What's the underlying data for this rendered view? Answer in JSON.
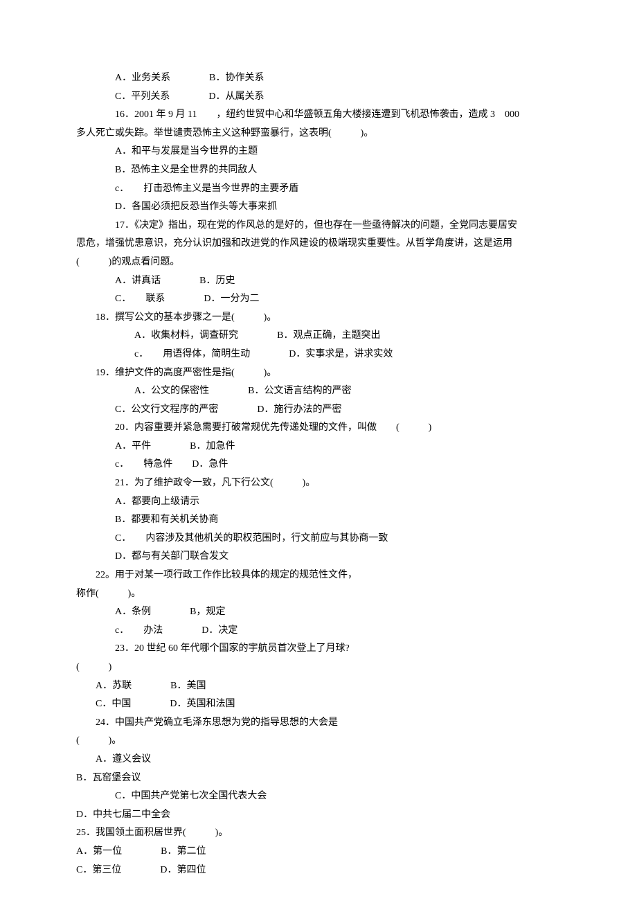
{
  "lines": [
    {
      "cls": "indent1",
      "text": "A．业务关系　　　　B．协作关系"
    },
    {
      "cls": "indent1",
      "text": "C．平列关系　　　　D．从属关系"
    },
    {
      "cls": "indent1",
      "text": "16．2001 年 9 月 11　　，纽约世贸中心和华盛顿五角大楼接连遭到飞机恐怖袭击，造成 3　000"
    },
    {
      "cls": "indent0",
      "text": "多人死亡或失踪。举世谴责恐怖主义这种野蛮暴行，这表明(　　　)。"
    },
    {
      "cls": "indent1",
      "text": "A．和平与发展是当今世界的主题"
    },
    {
      "cls": "indent1",
      "text": "B．恐怖主义是全世界的共同敌人"
    },
    {
      "cls": "indent1",
      "text": "c．　　打击恐怖主义是当今世界的主要矛盾"
    },
    {
      "cls": "indent1",
      "text": "D．各国必须把反恐当作头等大事来抓"
    },
    {
      "cls": "indent1",
      "text": "17．《决定》指出，现在党的作风总的是好的，但也存在一些亟待解决的问题，全党同志要居安"
    },
    {
      "cls": "indent0",
      "text": "思危，增强忧患意识，充分认识加强和改进党的作风建设的极端现实重要性。从哲学角度讲，这是运用"
    },
    {
      "cls": "indent0",
      "text": "(　　　)的观点看问题。"
    },
    {
      "cls": "indent1",
      "text": "A．讲真话　　　　B．历史"
    },
    {
      "cls": "indent1",
      "text": "C．　　联系　　　　D．一分为二"
    },
    {
      "cls": "indent-small",
      "text": "18．撰写公文的基本步骤之一是(　　　)。"
    },
    {
      "cls": "indent2",
      "text": "A．收集材料，调查研究　　　　B．观点正确，主题突出"
    },
    {
      "cls": "indent2",
      "text": "c．　　用语得体，简明生动　　　　D．实事求是，讲求实效"
    },
    {
      "cls": "indent-small",
      "text": "19．维护文件的高度严密性是指(　　　)。"
    },
    {
      "cls": "indent2",
      "text": "A．公文的保密性　　　　B．公文语言结构的严密"
    },
    {
      "cls": "indent1",
      "text": "C．公文行文程序的严密　　　　D．施行办法的严密"
    },
    {
      "cls": "indent1",
      "text": "20．内容重要并紧急需要打破常规优先传递处理的文件，叫做　　(　　　)"
    },
    {
      "cls": "indent1",
      "text": "A．平件　　　　B．加急件"
    },
    {
      "cls": "indent1",
      "text": "c．　　特急件　　D．急件"
    },
    {
      "cls": "indent1",
      "text": "21．为了维护政令一致，凡下行公文(　　　)。"
    },
    {
      "cls": "indent1",
      "text": "A．都要向上级请示"
    },
    {
      "cls": "indent1",
      "text": "B．都要和有关机关协商"
    },
    {
      "cls": "indent1",
      "text": "C．　　内容涉及其他机关的职权范围时，行文前应与其协商一致"
    },
    {
      "cls": "indent1",
      "text": "D．都与有关部门联合发文"
    },
    {
      "cls": "indent-small",
      "text": "22。用于对某一项行政工作作比较具体的规定的规范性文件，"
    },
    {
      "cls": "indent0",
      "text": "称作(　　　)。"
    },
    {
      "cls": "indent1",
      "text": "A．条例　　　　B，规定"
    },
    {
      "cls": "indent1",
      "text": "c．　　办法　　　　D．决定"
    },
    {
      "cls": "indent1",
      "text": "23．20 世纪 60 年代哪个国家的宇航员首次登上了月球?"
    },
    {
      "cls": "indent0",
      "text": "(　　　)"
    },
    {
      "cls": "indent-small",
      "text": "A．苏联　　　　B．美国"
    },
    {
      "cls": "indent-small",
      "text": "C．中国　　　　D．英国和法国"
    },
    {
      "cls": "indent-small",
      "text": "24．中国共产党确立毛泽东思想为党的指导思想的大会是"
    },
    {
      "cls": "indent0",
      "text": "(　　　)。"
    },
    {
      "cls": "indent-small",
      "text": "A．遵义会议"
    },
    {
      "cls": "indent0",
      "text": "B．瓦窑堡会议"
    },
    {
      "cls": "indent1",
      "text": "C．中国共产党第七次全国代表大会"
    },
    {
      "cls": "indent0",
      "text": "D．中共七届二中全会"
    },
    {
      "cls": "indent0",
      "text": "25．我国领土面积居世界(　　　)。"
    },
    {
      "cls": "indent0",
      "text": "A．第一位　　　　B．第二位"
    },
    {
      "cls": "indent0",
      "text": "C．第三位　　　　D．第四位"
    }
  ]
}
